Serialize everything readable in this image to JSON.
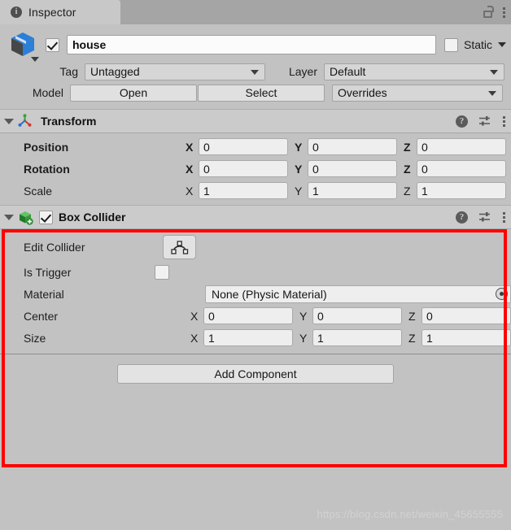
{
  "window": {
    "tab_title": "Inspector",
    "tab_icon": "info-icon",
    "lock_icon": "lock-open-icon",
    "menu_icon": "kebab-menu-icon"
  },
  "gameobject": {
    "icon": "prefab-model-cube-icon",
    "enabled": true,
    "name": "house",
    "static_checked": false,
    "static_label": "Static",
    "tag_label": "Tag",
    "tag_value": "Untagged",
    "layer_label": "Layer",
    "layer_value": "Default",
    "model_label": "Model",
    "open_button": "Open",
    "select_button": "Select",
    "overrides_value": "Overrides"
  },
  "transform": {
    "title": "Transform",
    "icon": "transform-axis-gizmo-icon",
    "expanded": true,
    "rows": [
      {
        "label": "Position",
        "bold": true,
        "x": "0",
        "y": "0",
        "z": "0"
      },
      {
        "label": "Rotation",
        "bold": true,
        "x": "0",
        "y": "0",
        "z": "0"
      },
      {
        "label": "Scale",
        "bold": false,
        "x": "1",
        "y": "1",
        "z": "1"
      }
    ],
    "axis_labels": {
      "x": "X",
      "y": "Y",
      "z": "Z"
    }
  },
  "box_collider": {
    "title": "Box Collider",
    "icon": "box-collider-green-cube-icon",
    "enabled": true,
    "expanded": true,
    "edit_collider_label": "Edit Collider",
    "edit_collider_icon": "edit-collider-polygon-icon",
    "is_trigger_label": "Is Trigger",
    "is_trigger_checked": false,
    "material_label": "Material",
    "material_value": "None (Physic Material)",
    "material_picker_icon": "object-picker-icon",
    "rows": [
      {
        "label": "Center",
        "x": "0",
        "y": "0",
        "z": "0"
      },
      {
        "label": "Size",
        "x": "1",
        "y": "1",
        "z": "1"
      }
    ],
    "axis_labels": {
      "x": "X",
      "y": "Y",
      "z": "Z"
    }
  },
  "component_header_icons": {
    "help": "help-question-icon",
    "preset": "preset-sliders-icon",
    "menu": "kebab-menu-icon"
  },
  "footer": {
    "add_component_label": "Add Component"
  },
  "watermark": {
    "text": "https://blog.csdn.net/weixin_45655555"
  },
  "colors": {
    "highlight": "#fe0000",
    "panel_bg": "#c2c2c2",
    "header_bg": "#cbcbcb",
    "toolbar_bg": "#a5a5a5"
  }
}
